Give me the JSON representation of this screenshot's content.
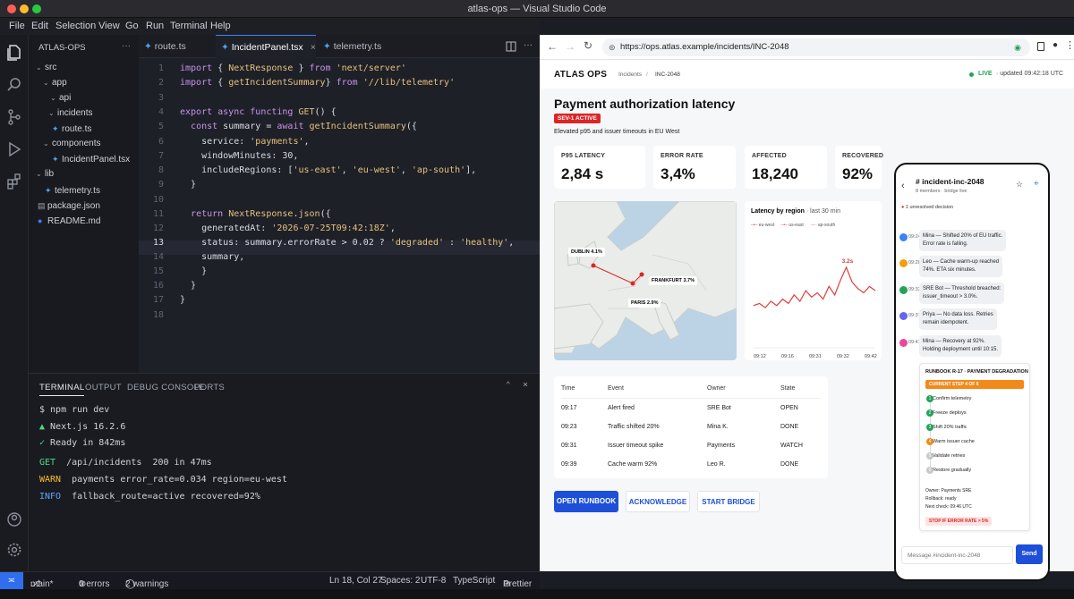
{
  "window": {
    "title": "atlas-ops — Visual Studio Code"
  },
  "menu": {
    "file": "File",
    "edit": "Edit",
    "selection": "Selection",
    "view": "View",
    "go": "Go",
    "run": "Run",
    "terminal": "Terminal",
    "help": "Help"
  },
  "sidebar": {
    "title": "ATLAS-OPS",
    "more": "···",
    "items": [
      {
        "label": "src",
        "icon": "chevron-down"
      },
      {
        "label": "app",
        "icon": "chevron-down"
      },
      {
        "label": "api",
        "icon": "chevron-down"
      },
      {
        "label": "incidents",
        "icon": "chevron-down"
      },
      {
        "label": "route.ts",
        "icon": "ts-file"
      },
      {
        "label": "components",
        "icon": "chevron-down"
      },
      {
        "label": "IncidentPanel.tsx",
        "icon": "react-file"
      },
      {
        "label": "lib",
        "icon": "chevron-down"
      },
      {
        "label": "telemetry.ts",
        "icon": "ts-file"
      },
      {
        "label": "package.json",
        "icon": "json-file"
      },
      {
        "label": "README.md",
        "icon": "info-file"
      }
    ]
  },
  "tabs": [
    {
      "label": "route.ts"
    },
    {
      "label": "IncidentPanel.tsx",
      "close": "×"
    },
    {
      "label": "telemetry.ts"
    }
  ],
  "code": {
    "line_numbers": [
      "1",
      "2",
      "3",
      "4",
      "5",
      "6",
      "7",
      "8",
      "9",
      "10",
      "11",
      "12",
      "13",
      "14",
      "15",
      "16",
      "17",
      "18"
    ]
  },
  "terminal": {
    "tabs": [
      "TERMINAL",
      "OUTPUT",
      "DEBUG CONSOLE",
      "PORTS"
    ],
    "lines": {
      "l1": "$ npm run dev",
      "l2": "Next.js 16.2.6",
      "l3": "Ready in 842ms",
      "l4a": "GET",
      "l4b": "/api/incidents  200 in 47ms",
      "l5a": "WARN",
      "l5b": "payments error_rate=0.034 region=eu-west",
      "l6a": "INFO",
      "l6b": "fallback_route=active recovered=92%"
    }
  },
  "status": {
    "branch": "main*",
    "errors": "0 errors",
    "warnings": "2 warnings",
    "position": "Ln 18, Col 27",
    "spaces": "Spaces: 2",
    "encoding": "UTF-8",
    "language": "TypeScript",
    "formatter": "Prettier"
  },
  "browser": {
    "url": "https://ops.atlas.example/incidents/INC-2048"
  },
  "app": {
    "logo": "ATLAS OPS",
    "breadcrumb1": "Incidents",
    "breadcrumb_sep": "/",
    "breadcrumb2": "INC-2048",
    "live": "LIVE",
    "updated": "· updated 09:42:18 UTC",
    "title": "Payment authorization latency",
    "sev": "SEV-1 ACTIVE",
    "subtitle": "Elevated p95 and issuer timeouts in EU West",
    "kpis": [
      {
        "label": "P95 LATENCY",
        "value": "2,84 s"
      },
      {
        "label": "ERROR RATE",
        "value": "3,4%"
      },
      {
        "label": "AFFECTED",
        "value": "18,240"
      },
      {
        "label": "RECOVERED",
        "value": "92%"
      }
    ],
    "map": {
      "dublin": "DUBLIN 4.1%",
      "frankfurt": "FRANKFURT 3.7%",
      "paris": "PARIS  2.9%"
    },
    "chart_data": {
      "type": "line",
      "title": "Latency by region",
      "subtitle": "· last 30 min",
      "legend": [
        "eu-west",
        "us-east",
        "ap-south"
      ],
      "x": [
        "09:12",
        "09:16",
        "09:31",
        "09:32",
        "09:42"
      ],
      "peak_label": "3.2s",
      "series": [
        {
          "name": "eu-west",
          "values": [
            1.4,
            1.5,
            1.3,
            1.6,
            1.4,
            1.7,
            1.5,
            1.9,
            1.6,
            2.1,
            1.8,
            2.0,
            1.7,
            2.3,
            1.9,
            2.6,
            3.2,
            2.5,
            2.2,
            2.0,
            2.3,
            2.1
          ]
        }
      ],
      "ylim": [
        0,
        4
      ],
      "colors": {
        "eu-west": "#e03a3a"
      }
    },
    "table": {
      "headers": [
        "Time",
        "Event",
        "Owner",
        "State"
      ],
      "rows": [
        [
          "09:17",
          "Alert fired",
          "SRE Bot",
          "OPEN"
        ],
        [
          "09:23",
          "Traffic shifted 20%",
          "Mina K.",
          "DONE"
        ],
        [
          "09:31",
          "Issuer timeout spike",
          "Payments",
          "WATCH"
        ],
        [
          "09:39",
          "Cache warm 92%",
          "Leo R.",
          "DONE"
        ]
      ]
    },
    "buttons": {
      "runbook": "OPEN RUNBOOK",
      "ack": "ACKNOWLEDGE",
      "bridge": "START BRIDGE"
    }
  },
  "phone": {
    "channel": "# incident-inc-2048",
    "meta": "8 members · bridge live",
    "unresolved": "1 unresolved decision",
    "messages": [
      {
        "time": "09:24",
        "text1": "Mina — Shifted 20% of EU traffic.",
        "text2": "Error rate is falling.",
        "color": "#3b82f6"
      },
      {
        "time": "09:28",
        "text1": "Leo — Cache warm-up reached",
        "text2": "74%. ETA six minutes.",
        "color": "#f59e0b"
      },
      {
        "time": "09:33",
        "text1": "SRE Bot — Threshold breached:",
        "text2": "issuer_timeout > 3.0%.",
        "color": "#22a35a"
      },
      {
        "time": "09:37",
        "text1": "Priya — No data loss. Retries",
        "text2": "remain idempotent.",
        "color": "#6366f1"
      },
      {
        "time": "09:41",
        "text1": "Mina — Recovery at 92%.",
        "text2": "Holding deployment until 10:15.",
        "color": "#ec4899"
      }
    ],
    "runbook": {
      "title": "RUNBOOK R-17 · PAYMENT DEGRADATION",
      "current": "CURRENT STEP 4 OF 6",
      "steps": [
        {
          "n": "1",
          "label": "Confirm telemetry",
          "state": "done"
        },
        {
          "n": "2",
          "label": "Freeze deploys",
          "state": "done"
        },
        {
          "n": "3",
          "label": "Shift 20% traffic",
          "state": "done"
        },
        {
          "n": "4",
          "label": "Warm issuer cache",
          "state": "current"
        },
        {
          "n": "5",
          "label": "Validate retries",
          "state": "todo"
        },
        {
          "n": "6",
          "label": "Restore gradually",
          "state": "todo"
        }
      ],
      "owner": "Owner: Payments SRE",
      "rollback": "Rollback: ready",
      "next": "Next check: 09:46 UTC",
      "stop": "STOP IF ERROR RATE > 5%"
    },
    "input_placeholder": "Message #incident-inc-2048",
    "send": "Send"
  }
}
